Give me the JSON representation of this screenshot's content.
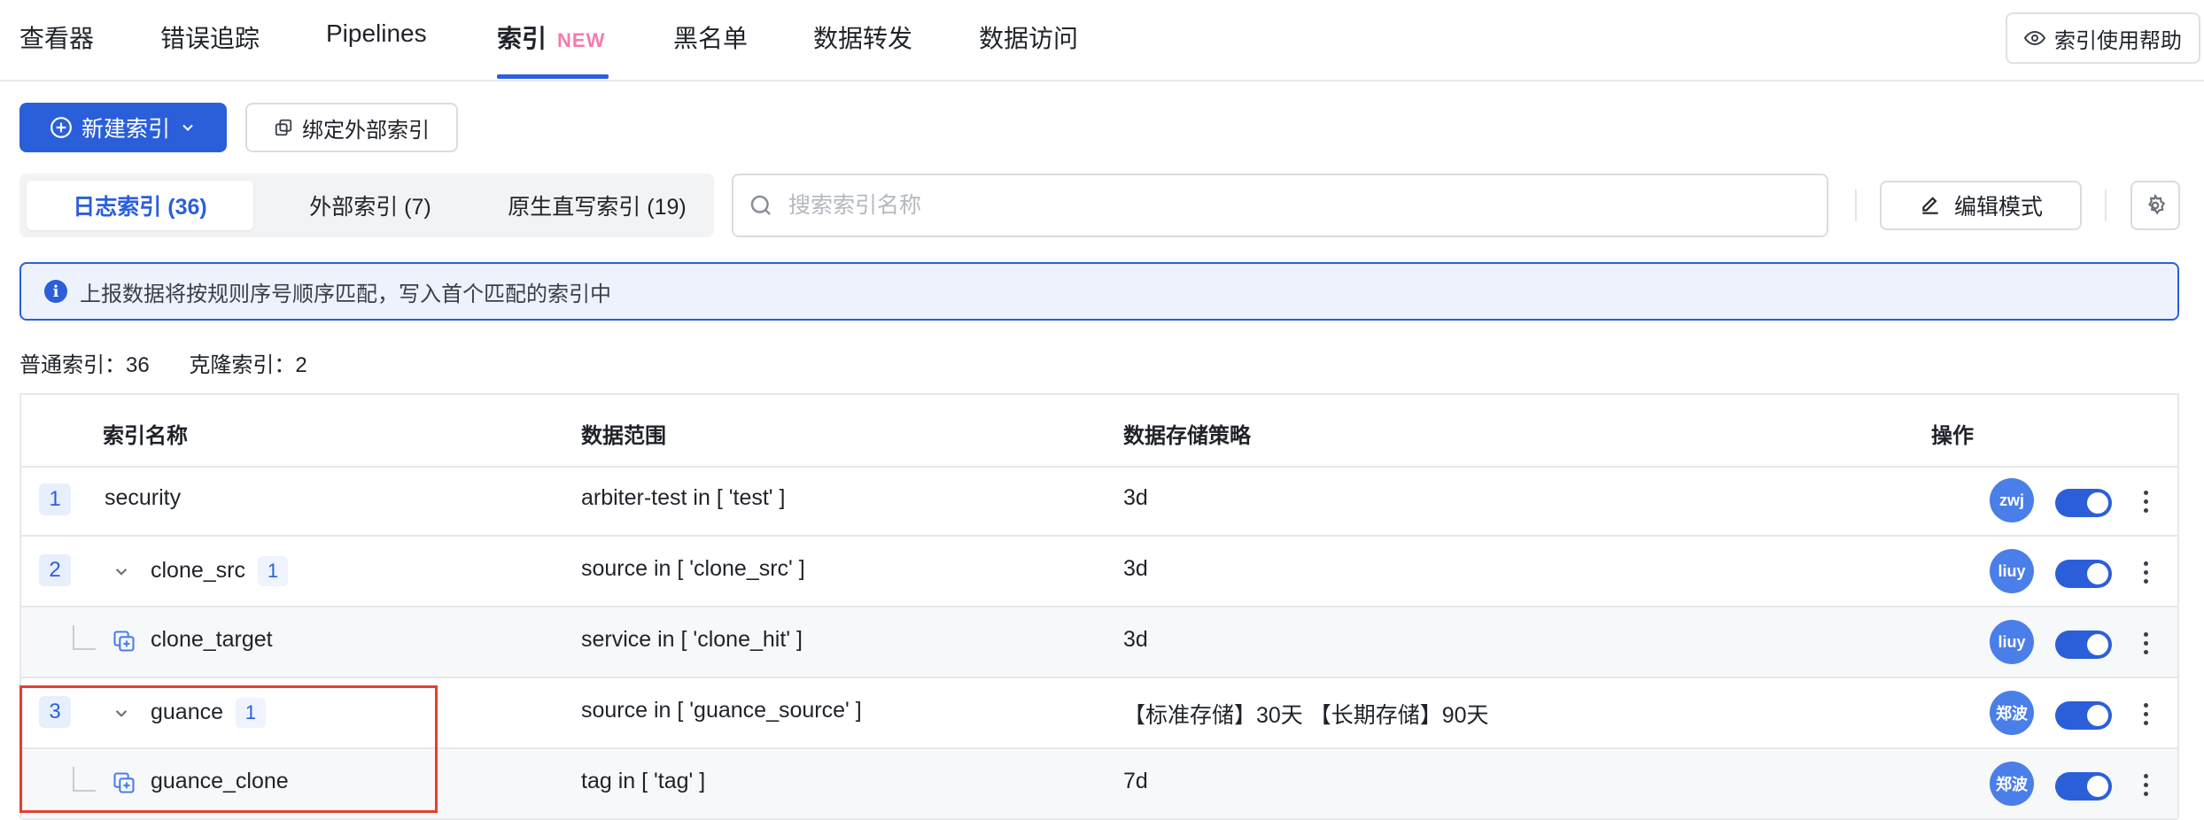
{
  "nav": {
    "tabs": [
      "查看器",
      "错误追踪",
      "Pipelines",
      "索引",
      "黑名单",
      "数据转发",
      "数据访问"
    ],
    "active_badge": "NEW",
    "help_label": "索引使用帮助"
  },
  "toolbar": {
    "new_index_label": "新建索引",
    "bind_external_label": "绑定外部索引",
    "edit_mode_label": "编辑模式"
  },
  "index_tabs": [
    "日志索引 (36)",
    "外部索引 (7)",
    "原生直写索引 (19)"
  ],
  "search": {
    "placeholder": "搜索索引名称"
  },
  "info_text": "上报数据将按规则序号顺序匹配，写入首个匹配的索引中",
  "counts": {
    "normal": "普通索引：36",
    "clone": "克隆索引：2"
  },
  "table": {
    "headers": [
      "索引名称",
      "数据范围",
      "数据存储策略",
      "操作"
    ],
    "rows": [
      {
        "seq": "1",
        "name": "security",
        "scope": "arbiter-test in [ 'test' ]",
        "policy": "3d",
        "owner": "zwj",
        "enabled": true
      },
      {
        "seq": "2",
        "name": "clone_src",
        "count": "1",
        "scope": "source in [ 'clone_src' ]",
        "policy": "3d",
        "owner": "liuy",
        "enabled": true
      },
      {
        "name": "clone_target",
        "scope": "service in [ 'clone_hit' ]",
        "policy": "3d",
        "owner": "liuy",
        "enabled": true
      },
      {
        "seq": "3",
        "name": "guance",
        "count": "1",
        "scope": "source in [ 'guance_source' ]",
        "policy": "【标准存储】30天 【长期存储】90天",
        "owner": "郑波",
        "enabled": true
      },
      {
        "name": "guance_clone",
        "scope": "tag in [ 'tag' ]",
        "policy": "7d",
        "owner": "郑波",
        "enabled": true
      }
    ]
  },
  "colors": {
    "primary": "#2b5fd9",
    "badge_pink": "#f47ab1",
    "highlight_red": "#e53e30"
  }
}
